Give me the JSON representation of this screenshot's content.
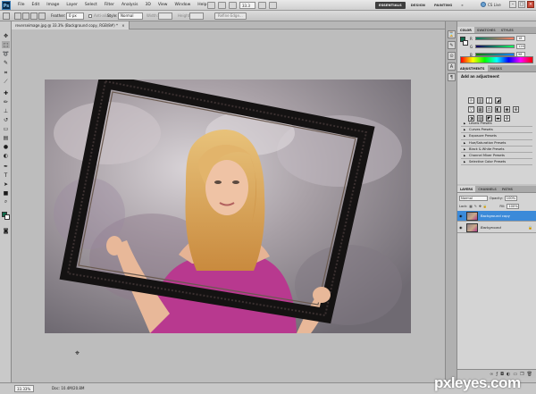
{
  "app": {
    "logo_text": "Ps",
    "menu": [
      "File",
      "Edit",
      "Image",
      "Layer",
      "Select",
      "Filter",
      "Analysis",
      "3D",
      "View",
      "Window",
      "Help"
    ],
    "zoom_selector": "33.3",
    "workspaces": [
      {
        "label": "ESSENTIALS",
        "active": true
      },
      {
        "label": "DESIGN",
        "active": false
      },
      {
        "label": "PAINTING",
        "active": false
      }
    ],
    "more_workspaces": "»",
    "cs_live": "CS Live",
    "window_controls": {
      "minimize": "–",
      "maximize": "□",
      "close": "×"
    }
  },
  "options_bar": {
    "feather_label": "Feather:",
    "feather_value": "0 px",
    "antialias_label": "Anti-alias",
    "style_label": "Style:",
    "style_value": "Normal",
    "width_label": "Width:",
    "height_label": "Height:",
    "refine_edge": "Refine Edge..."
  },
  "document": {
    "tab_title": "reverseimage.jpg @ 33.3% (Background copy, RGB/8#) *",
    "close": "×"
  },
  "status_bar": {
    "zoom": "33.33%",
    "doc_size": "Doc: 10.4M/20.8M"
  },
  "panels": {
    "color_tabs": [
      {
        "label": "COLOR",
        "active": true
      },
      {
        "label": "SWATCHES",
        "active": false
      },
      {
        "label": "STYLES",
        "active": false
      }
    ],
    "color_values": {
      "r": {
        "label": "R",
        "value": "18"
      },
      "g": {
        "label": "G",
        "value": "126"
      },
      "b": {
        "label": "B",
        "value": "98"
      }
    },
    "adjustment_tabs": [
      {
        "label": "ADJUSTMENTS",
        "active": true
      },
      {
        "label": "MASKS",
        "active": false
      }
    ],
    "adjustment_title": "Add an adjustment",
    "presets": [
      "Levels Presets",
      "Curves Presets",
      "Exposure Presets",
      "Hue/Saturation Presets",
      "Black & White Presets",
      "Channel Mixer Presets",
      "Selective Color Presets"
    ],
    "layers_tabs": [
      {
        "label": "LAYERS",
        "active": true
      },
      {
        "label": "CHANNELS",
        "active": false
      },
      {
        "label": "PATHS",
        "active": false
      }
    ],
    "blend_mode": "Normal",
    "opacity_label": "Opacity:",
    "opacity_value": "100%",
    "lock_label": "Lock:",
    "fill_label": "Fill:",
    "fill_value": "100%",
    "layers": [
      {
        "name": "Background copy",
        "selected": true,
        "locked": false
      },
      {
        "name": "Background",
        "selected": false,
        "locked": true
      }
    ]
  },
  "colors": {
    "foreground": "#0e6a4a",
    "background": "#ffffff",
    "selection": "#3b8ad9"
  },
  "watermark": "pxleyes.com"
}
